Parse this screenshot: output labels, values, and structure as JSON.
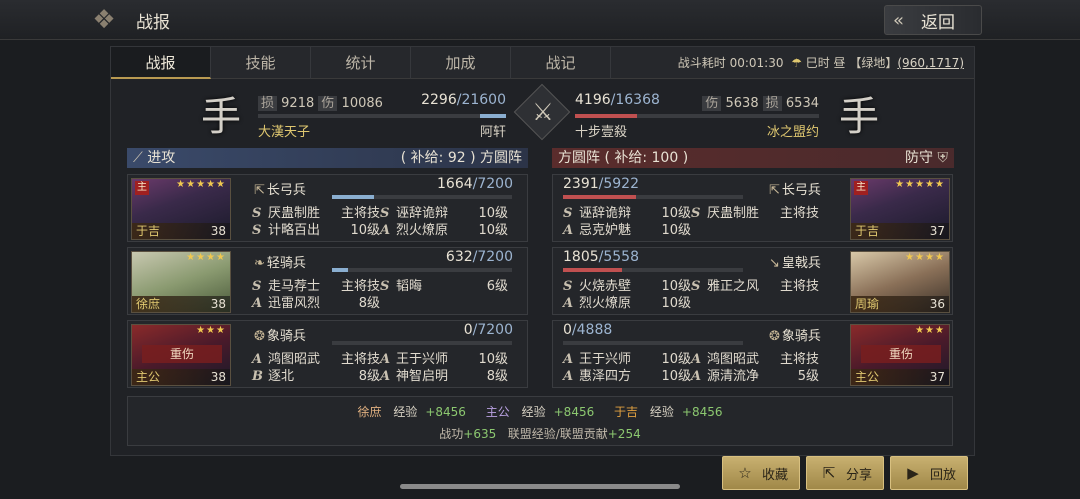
{
  "topbar": {
    "title": "战报",
    "back_label": "返回",
    "back_icon": "double-chevron-left-icon"
  },
  "tabs": [
    "战报",
    "技能",
    "统计",
    "加成",
    "战记"
  ],
  "battle_info": {
    "duration_label": "战斗耗时",
    "duration": "00:01:30",
    "weather": "巳时 昼",
    "terrain": "【绿地】",
    "coord": "(960,1717)"
  },
  "left_side": {
    "flag": "手",
    "loss_label": "损",
    "loss": "9218",
    "damage_label": "伤",
    "damage": "10086",
    "hp": "2296",
    "hp_max": "/21600",
    "hp_ratio": 0.106,
    "alliance": "大漢天子",
    "lord": "阿轩"
  },
  "right_side": {
    "flag": "手",
    "hp": "4196",
    "hp_max": "/16368",
    "hp_ratio": 0.256,
    "damage_label": "伤",
    "damage": "5638",
    "loss_label": "损",
    "loss": "6534",
    "lord": "十步壹殺",
    "alliance": "冰之盟约"
  },
  "left_formation": {
    "role": "进攻",
    "supply": "( 补给: 92 ) 方圆阵"
  },
  "right_formation": {
    "supply": "方圆阵 ( 补给: 100 )",
    "role": "防守"
  },
  "left_units": [
    {
      "name": "于吉",
      "level": "38",
      "main": "主",
      "stars": "★★★★★",
      "troop": "长弓兵",
      "count": "1664",
      "max": "/7200",
      "ratio": 0.231,
      "skills": [
        [
          "S",
          "厌蛊制胜",
          "主将技"
        ],
        [
          "S",
          "诬辞诡辩",
          "10级"
        ],
        [
          "S",
          "计略百出",
          "10级"
        ],
        [
          "A",
          "烈火燎原",
          "10级"
        ]
      ]
    },
    {
      "name": "徐庶",
      "level": "38",
      "stars": "★★★★",
      "troop": "轻骑兵",
      "count": "632",
      "max": "/7200",
      "ratio": 0.088,
      "skills": [
        [
          "S",
          "走马荐士",
          "主将技"
        ],
        [
          "S",
          "韬晦",
          "6级"
        ],
        [
          "A",
          "迅雷风烈",
          "8级"
        ]
      ]
    },
    {
      "name": "主公",
      "level": "38",
      "stars": "★★★",
      "injured": "重伤",
      "troop": "象骑兵",
      "count": "0",
      "max": "/7200",
      "ratio": 0,
      "skills": [
        [
          "A",
          "鸿图昭武",
          "主将技"
        ],
        [
          "A",
          "王于兴师",
          "10级"
        ],
        [
          "B",
          "逐北",
          "8级"
        ],
        [
          "A",
          "神智启明",
          "8级"
        ]
      ]
    }
  ],
  "right_units": [
    {
      "name": "于吉",
      "level": "37",
      "main": "主",
      "stars": "★★★★★",
      "troop": "长弓兵",
      "count": "2391",
      "max": "/5922",
      "ratio": 0.404,
      "skills": [
        [
          "S",
          "诬辞诡辩",
          "10级"
        ],
        [
          "S",
          "厌蛊制胜",
          "主将技"
        ],
        [
          "A",
          "忌克妒魅",
          "10级"
        ]
      ]
    },
    {
      "name": "周瑜",
      "level": "36",
      "stars": "★★★★",
      "troop": "皇戟兵",
      "count": "1805",
      "max": "/5558",
      "ratio": 0.325,
      "skills": [
        [
          "S",
          "火烧赤壁",
          "10级"
        ],
        [
          "S",
          "雅正之风",
          "主将技"
        ],
        [
          "A",
          "烈火燎原",
          "10级"
        ]
      ]
    },
    {
      "name": "主公",
      "level": "37",
      "stars": "★★★",
      "injured": "重伤",
      "troop": "象骑兵",
      "count": "0",
      "max": "/4888",
      "ratio": 0,
      "skills": [
        [
          "A",
          "王于兴师",
          "10级"
        ],
        [
          "A",
          "鸿图昭武",
          "主将技"
        ],
        [
          "A",
          "惠泽四方",
          "10级"
        ],
        [
          "A",
          "源清流净",
          "5级"
        ]
      ]
    }
  ],
  "summary": {
    "exp": [
      {
        "name": "徐庶",
        "label": "经验",
        "value": "+8456",
        "color": "#e0b080"
      },
      {
        "name": "主公",
        "label": "经验",
        "value": "+8456",
        "color": "#b8a0e0"
      },
      {
        "name": "于吉",
        "label": "经验",
        "value": "+8456",
        "color": "#e0a040"
      }
    ],
    "merit_label": "战功",
    "merit": "+635",
    "alliance_label": "联盟经验/联盟贡献",
    "alliance_value": "+254"
  },
  "buttons": [
    {
      "label": "收藏",
      "icon": "star-icon"
    },
    {
      "label": "分享",
      "icon": "share-icon"
    },
    {
      "label": "回放",
      "icon": "play-icon"
    }
  ],
  "colors": {
    "accent": "#b99a52",
    "attack": "#3a4a6a",
    "defend": "#5a2c2c",
    "hp_blue": "#8aaed0",
    "hp_red": "#c05050"
  }
}
